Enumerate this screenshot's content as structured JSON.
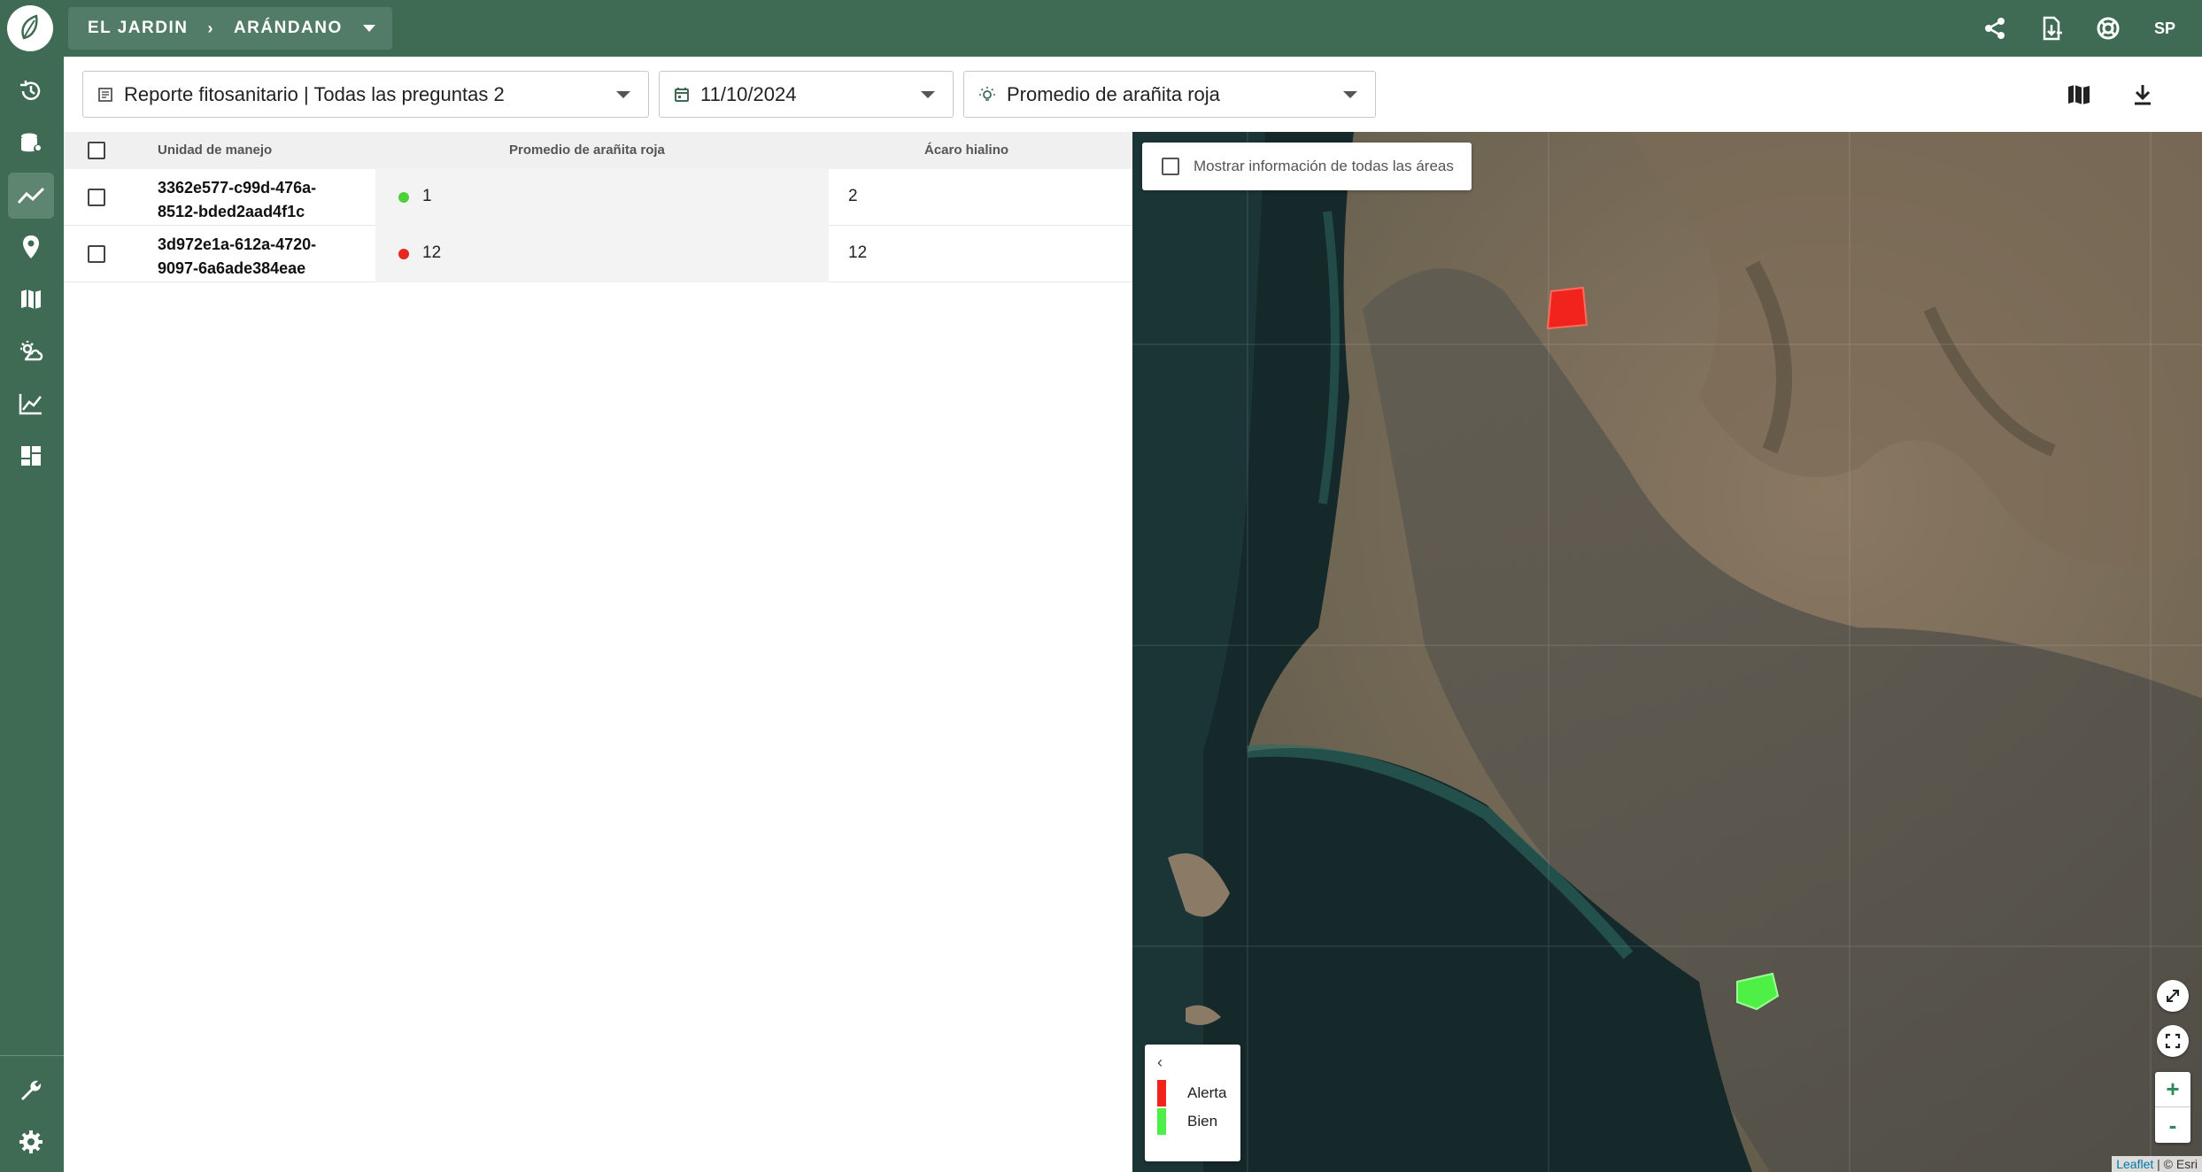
{
  "topbar": {
    "farm": "EL JARDIN",
    "separator": "›",
    "crop": "ARÁNDANO",
    "avatar": "SP",
    "icons": [
      "share-icon",
      "export-icon",
      "support-icon"
    ]
  },
  "sidebar": {
    "items": [
      {
        "icon": "history-icon"
      },
      {
        "icon": "database-pin-icon"
      },
      {
        "icon": "trend-icon",
        "active": true
      },
      {
        "icon": "location-pin-icon"
      },
      {
        "icon": "map-icon"
      },
      {
        "icon": "weather-icon"
      },
      {
        "icon": "chart-line-icon"
      },
      {
        "icon": "dashboard-icon"
      }
    ],
    "bottom": [
      {
        "icon": "wrench-icon"
      },
      {
        "icon": "settings-icon"
      }
    ]
  },
  "filters": {
    "report": "Reporte fitosanitario | Todas las preguntas 2",
    "date": "11/10/2024",
    "metric": "Promedio de arañita roja"
  },
  "table": {
    "headers": {
      "unit": "Unidad de manejo",
      "metric": "Promedio de arañita roja",
      "other": "Ácaro hialino"
    },
    "rows": [
      {
        "unit_line1": "3362e577-c99d-476a-",
        "unit_line2": "8512-bded2aad4f1c",
        "metric": "1",
        "status_color": "#4cd137",
        "other": "2"
      },
      {
        "unit_line1": "3d972e1a-612a-4720-",
        "unit_line2": "9097-6a6ade384eae",
        "metric": "12",
        "status_color": "#e8271e",
        "other": "12"
      }
    ]
  },
  "map": {
    "show_all_label": "Mostrar información de todas las áreas",
    "legend": {
      "toggle": "‹",
      "items": [
        {
          "label": "Alerta",
          "color": "#f0241c"
        },
        {
          "label": "Bien",
          "color": "#4ef045"
        }
      ]
    },
    "zoom_in": "+",
    "zoom_out": "-",
    "attribution_link": "Leaflet",
    "attribution_rest": " | © Esri"
  }
}
